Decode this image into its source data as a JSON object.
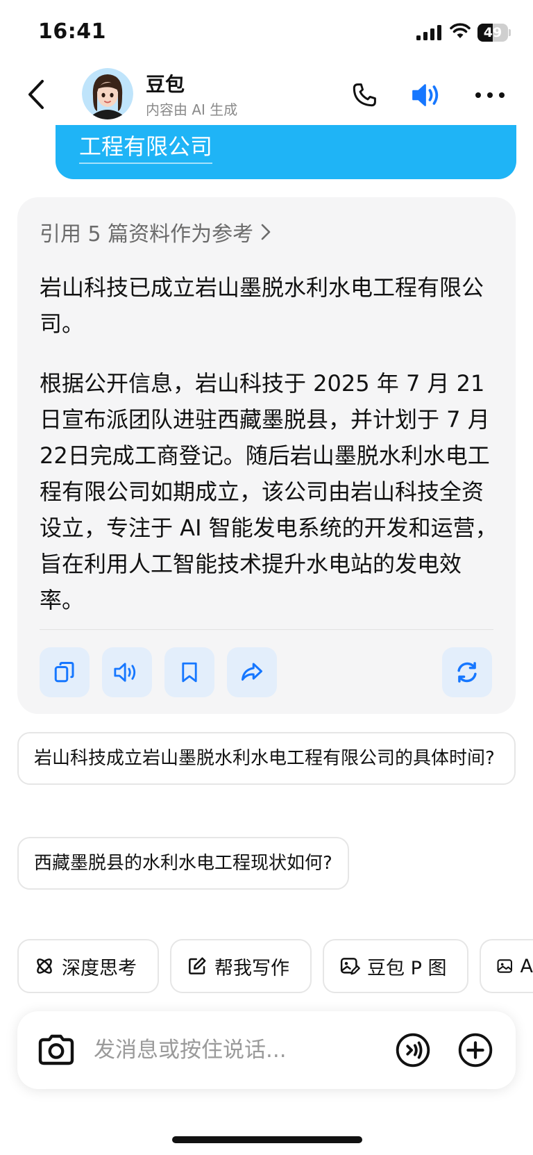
{
  "status_bar": {
    "time": "16:41",
    "battery_text": "49",
    "battery_level": 0.49
  },
  "header": {
    "back_icon": "chevron-left-icon",
    "bot_name": "豆包",
    "bot_subtitle": "内容由 AI 生成",
    "phone_icon": "phone-icon",
    "speaker_icon": "speaker-icon",
    "more_icon": "more-icon",
    "accent_color": "#1677ff"
  },
  "user_message": {
    "visible_text": "工程有限公司",
    "bubble_color": "#1fb4f6"
  },
  "answer": {
    "reference_label": "引用 5 篇资料作为参考",
    "paragraph_1": "岩山科技已成立岩山墨脱水利水电工程有限公司。",
    "paragraph_2": "根据公开信息，岩山科技于 2025 年 7 月 21 日宣布派团队进驻西藏墨脱县，并计划于 7 月 22日完成工商登记。随后岩山墨脱水利水电工程有限公司如期成立，该公司由岩山科技全资设立，专注于 AI 智能发电系统的开发和运营，旨在利用人工智能技术提升水电站的发电效率。",
    "actions": [
      {
        "icon": "copy-icon"
      },
      {
        "icon": "speaker-icon"
      },
      {
        "icon": "bookmark-icon"
      },
      {
        "icon": "share-icon"
      },
      {
        "icon": "regenerate-icon"
      }
    ]
  },
  "suggestions": [
    "岩山科技成立岩山墨脱水利水电工程有限公司的具体时间?",
    "西藏墨脱县的水利水电工程现状如何?"
  ],
  "tools": [
    {
      "icon": "deep-think-icon",
      "label": "深度思考"
    },
    {
      "icon": "edit-icon",
      "label": "帮我写作"
    },
    {
      "icon": "image-edit-icon",
      "label": "豆包 P 图"
    },
    {
      "icon": "image-icon",
      "label": "A"
    }
  ],
  "input": {
    "placeholder": "发消息或按住说话...",
    "value": "",
    "camera_icon": "camera-icon",
    "voice_icon": "voice-icon",
    "plus_icon": "plus-circle-icon"
  }
}
